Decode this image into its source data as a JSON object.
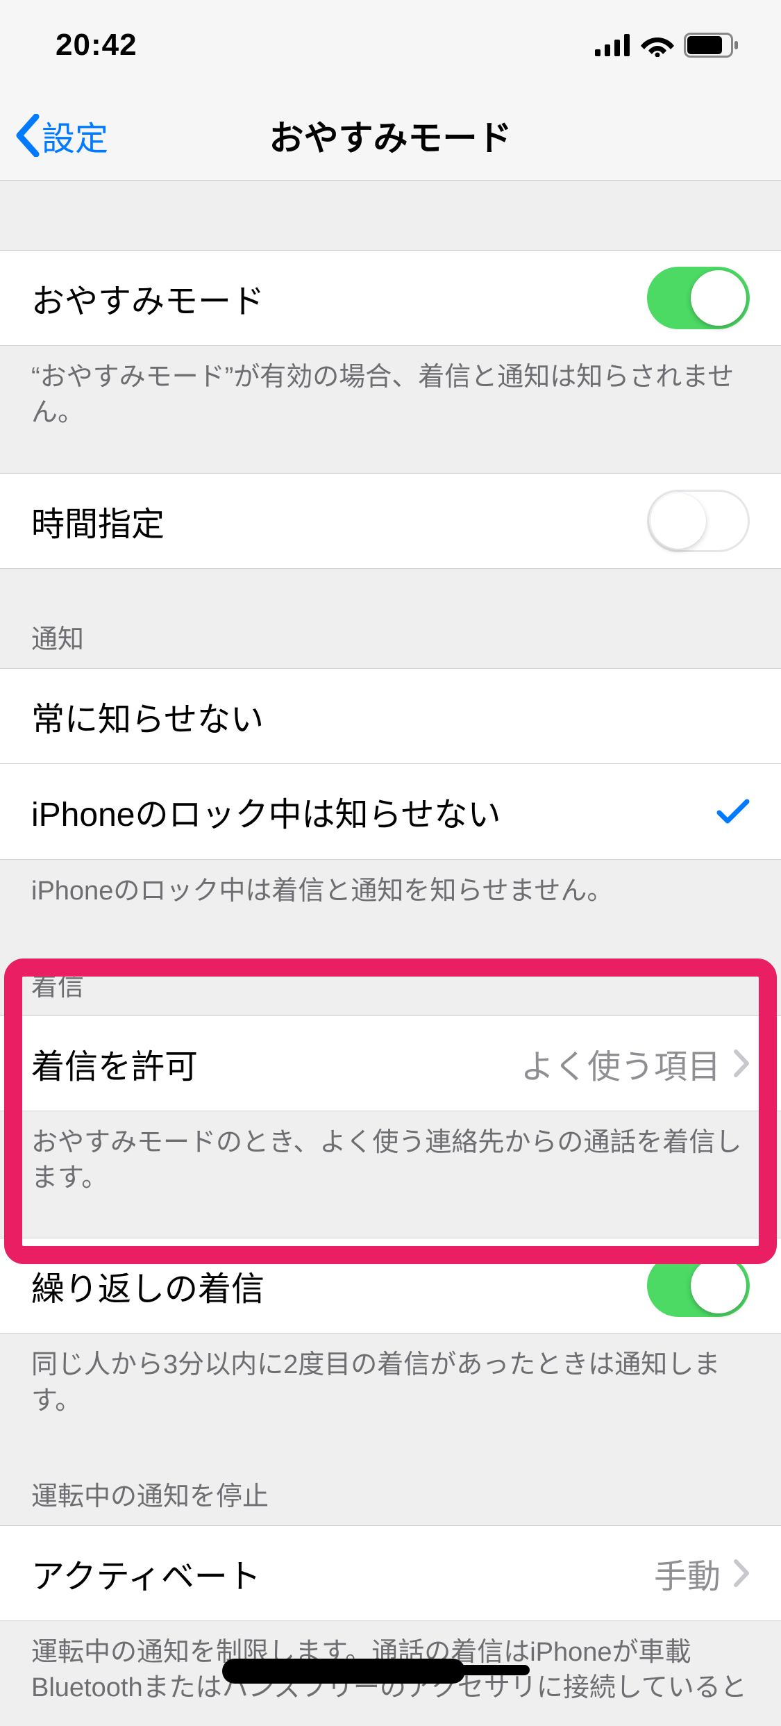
{
  "status": {
    "time": "20:42"
  },
  "nav": {
    "back": "設定",
    "title": "おやすみモード"
  },
  "dnd": {
    "label": "おやすみモード",
    "on": true,
    "footer": "“おやすみモード”が有効の場合、着信と通知は知らされません。"
  },
  "schedule": {
    "label": "時間指定",
    "on": false
  },
  "silence": {
    "header": "通知",
    "always": "常に知らせない",
    "locked": "iPhoneのロック中は知らせない",
    "selected": "locked",
    "footer": "iPhoneのロック中は着信と通知を知らせません。"
  },
  "calls": {
    "header": "着信",
    "allow_label": "着信を許可",
    "allow_value": "よく使う項目",
    "footer": "おやすみモードのとき、よく使う連絡先からの通話を着信します。"
  },
  "repeat": {
    "label": "繰り返しの着信",
    "on": true,
    "footer": "同じ人から3分以内に2度目の着信があったときは通知します。"
  },
  "driving": {
    "header": "運転中の通知を停止",
    "activate_label": "アクティベート",
    "activate_value": "手動",
    "footer": "運転中の通知を制限します。通話の着信はiPhoneが車載Bluetoothまたはハンズフリーのアクセサリに接続していると"
  }
}
